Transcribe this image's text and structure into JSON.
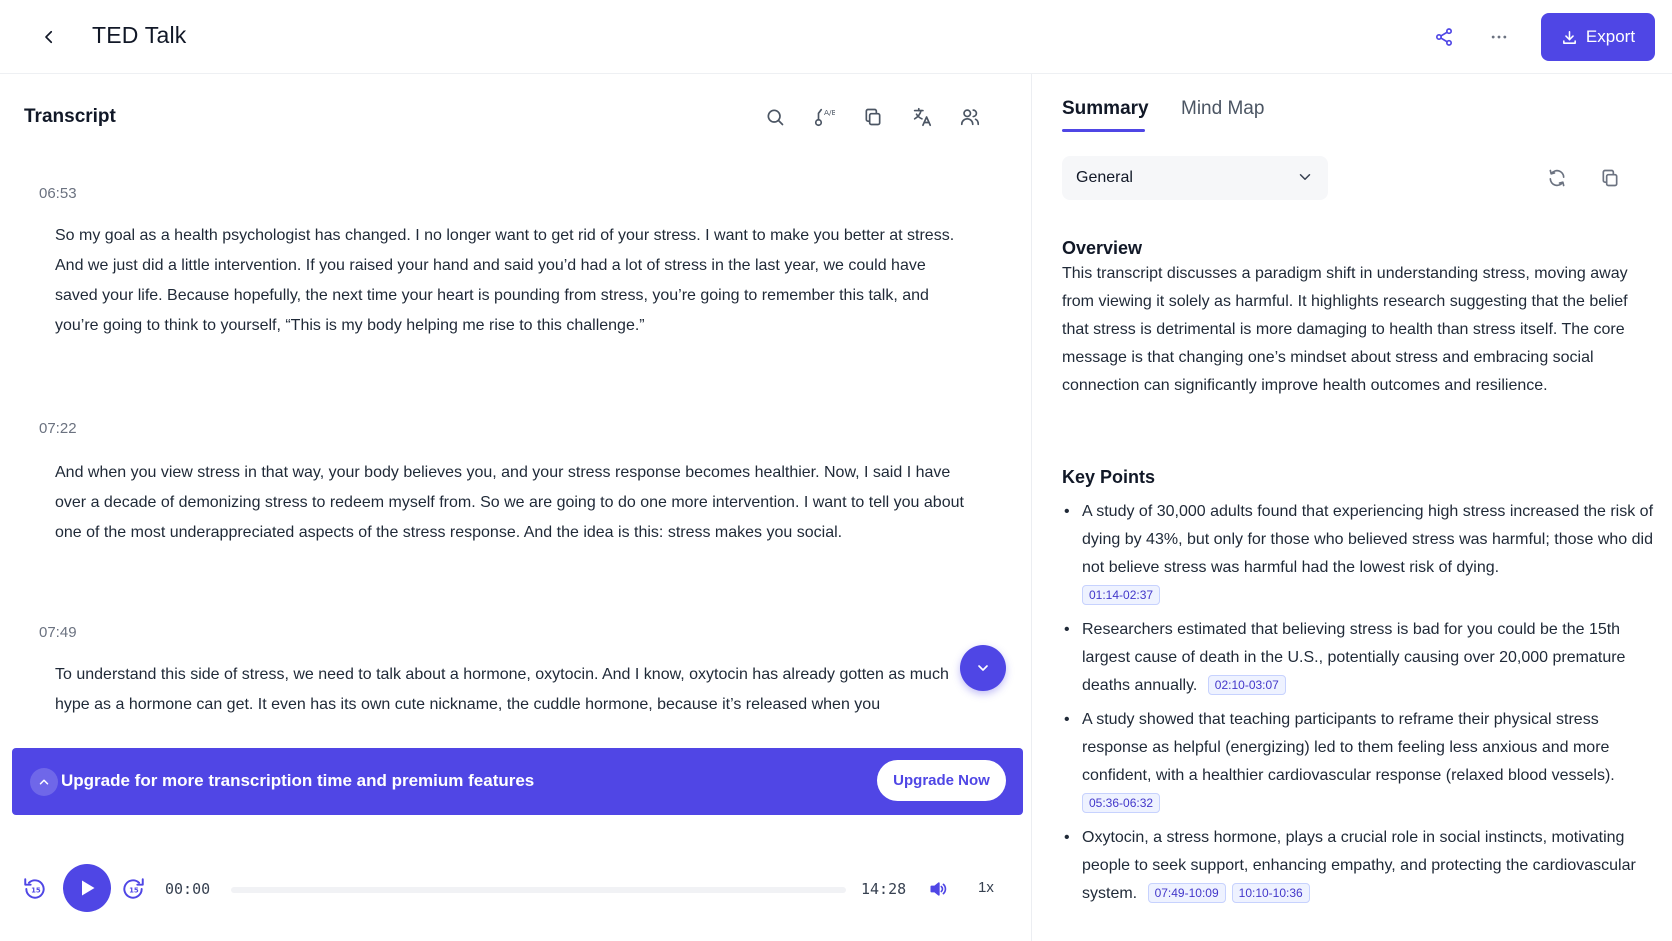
{
  "header": {
    "title": "TED Talk",
    "export_label": "Export"
  },
  "transcript": {
    "title": "Transcript",
    "segments": [
      {
        "time": "06:53",
        "text": "So my goal as a health psychologist has changed. I no longer want to get rid of your stress. I want to make you better at stress. And we just did a little intervention. If you raised your hand and said you’d had a lot of stress in the last year, we could have saved your life. Because hopefully, the next time your heart is pounding from stress, you’re going to remember this talk, and you’re going to think to yourself, “This is my body helping me rise to this challenge.”"
      },
      {
        "time": "07:22",
        "text": "And when you view stress in that way, your body believes you, and your stress response becomes healthier. Now, I said I have over a decade of demonizing stress to redeem myself from. So we are going to do one more intervention. I want to tell you about one of the most underappreciated aspects of the stress response. And the idea is this: stress makes you social."
      },
      {
        "time": "07:49",
        "text": "To understand this side of stress, we need to talk about a hormone, oxytocin. And I know, oxytocin has already gotten as much hype as a hormone can get. It even has its own cute nickname, the cuddle hormone, because it’s released when you"
      }
    ]
  },
  "upgrade": {
    "text": "Upgrade for more transcription time and premium features",
    "button_label": "Upgrade Now"
  },
  "player": {
    "current_time": "00:00",
    "duration": "14:28",
    "speed": "1x",
    "progress": 0
  },
  "summary_panel": {
    "tabs": [
      {
        "label": "Summary",
        "active": true
      },
      {
        "label": "Mind Map",
        "active": false
      }
    ],
    "template_selected": "General",
    "overview_heading": "Overview",
    "overview_text": "This transcript discusses a paradigm shift in understanding stress, moving away from viewing it solely as harmful. It highlights research suggesting that the belief that stress is detrimental is more damaging to health than stress itself. The core message is that changing one’s mindset about stress and embracing social connection can significantly improve health outcomes and resilience.",
    "key_points_heading": "Key Points",
    "key_points": [
      {
        "text": "A study of 30,000 adults found that experiencing high stress increased the risk of dying by 43%, but only for those who believed stress was harmful; those who did not believe stress was harmful had the lowest risk of dying.",
        "ranges": [
          "01:14-02:37"
        ]
      },
      {
        "text": "Researchers estimated that believing stress is bad for you could be the 15th largest cause of death in the U.S., potentially causing over 20,000 premature deaths annually.",
        "ranges": [
          "02:10-03:07"
        ]
      },
      {
        "text": "A study showed that teaching participants to reframe their physical stress response as helpful (energizing) led to them feeling less anxious and more confident, with a healthier cardiovascular response (relaxed blood vessels).",
        "ranges": [
          "05:36-06:32"
        ]
      },
      {
        "text": "Oxytocin, a stress hormone, plays a crucial role in social instincts, motivating people to seek support, enhancing empathy, and protecting the cardiovascular system.",
        "ranges": [
          "07:49-10:09",
          "10:10-10:36"
        ]
      }
    ]
  },
  "colors": {
    "accent": "#4f46e5",
    "text": "#1f2937",
    "muted": "#6b7280"
  }
}
